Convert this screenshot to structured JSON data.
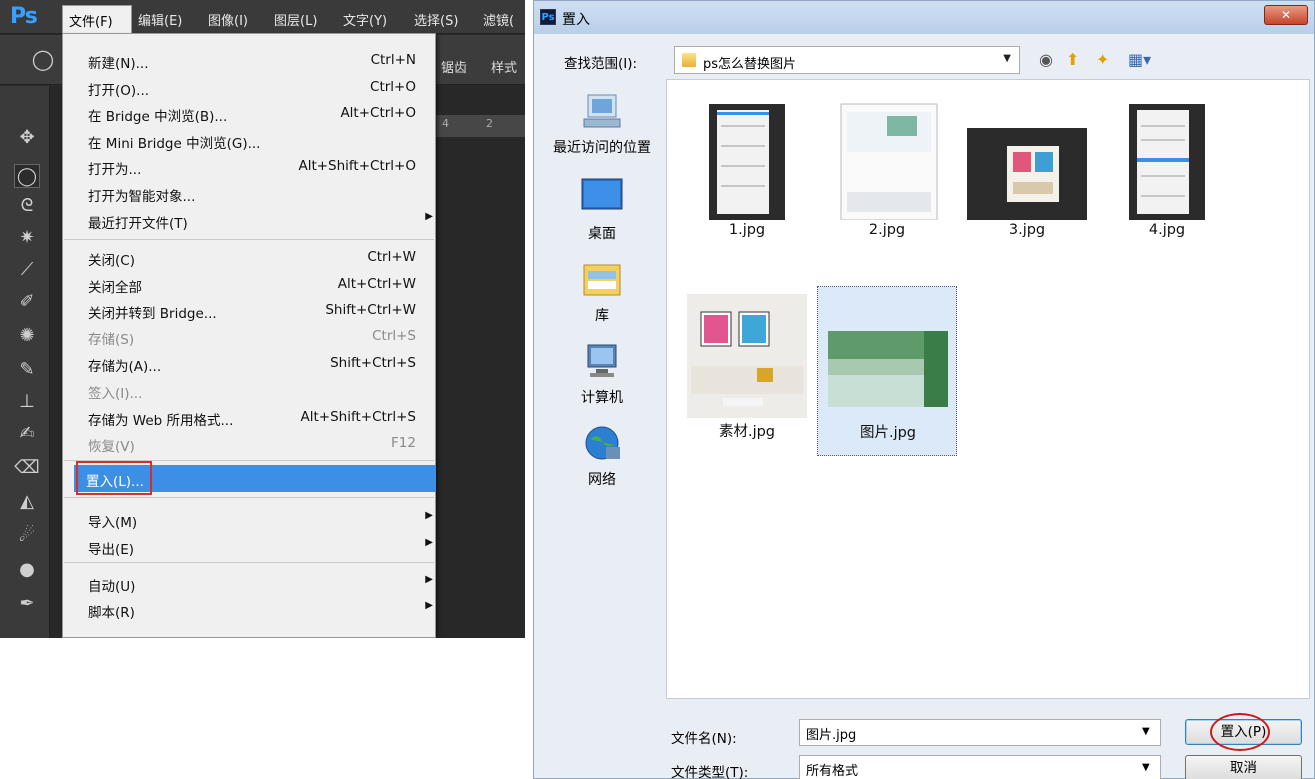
{
  "photoshop": {
    "logo": "Ps",
    "menubar": [
      {
        "label": "文件(F)"
      },
      {
        "label": "编辑(E)"
      },
      {
        "label": "图像(I)"
      },
      {
        "label": "图层(L)"
      },
      {
        "label": "文字(Y)"
      },
      {
        "label": "选择(S)"
      },
      {
        "label": "滤镜("
      }
    ],
    "optionbar": {
      "item1": "锯齿",
      "item2": "样式"
    },
    "ruler": {
      "tick1": "4",
      "tick2": "2"
    },
    "file_menu": {
      "items": [
        {
          "label": "新建(N)...",
          "shortcut": "Ctrl+N"
        },
        {
          "label": "打开(O)...",
          "shortcut": "Ctrl+O"
        },
        {
          "label": "在 Bridge 中浏览(B)...",
          "shortcut": "Alt+Ctrl+O"
        },
        {
          "label": "在 Mini Bridge 中浏览(G)...",
          "shortcut": ""
        },
        {
          "label": "打开为...",
          "shortcut": "Alt+Shift+Ctrl+O"
        },
        {
          "label": "打开为智能对象...",
          "shortcut": ""
        },
        {
          "label": "最近打开文件(T)",
          "shortcut": ""
        },
        {
          "label": "关闭(C)",
          "shortcut": "Ctrl+W"
        },
        {
          "label": "关闭全部",
          "shortcut": "Alt+Ctrl+W"
        },
        {
          "label": "关闭并转到 Bridge...",
          "shortcut": "Shift+Ctrl+W"
        },
        {
          "label": "存储(S)",
          "shortcut": "Ctrl+S"
        },
        {
          "label": "存储为(A)...",
          "shortcut": "Shift+Ctrl+S"
        },
        {
          "label": "签入(I)...",
          "shortcut": ""
        },
        {
          "label": "存储为 Web 所用格式...",
          "shortcut": "Alt+Shift+Ctrl+S"
        },
        {
          "label": "恢复(V)",
          "shortcut": "F12"
        },
        {
          "label": "置入(L)...",
          "shortcut": ""
        },
        {
          "label": "导入(M)",
          "shortcut": ""
        },
        {
          "label": "导出(E)",
          "shortcut": ""
        },
        {
          "label": "自动(U)",
          "shortcut": ""
        },
        {
          "label": "脚本(R)",
          "shortcut": ""
        }
      ]
    }
  },
  "dialog": {
    "title": "置入",
    "close": "✕",
    "look_in_label": "查找范围(I):",
    "look_in_value": "ps怎么替换图片",
    "places": [
      {
        "label": "最近访问的位置"
      },
      {
        "label": "桌面"
      },
      {
        "label": "库"
      },
      {
        "label": "计算机"
      },
      {
        "label": "网络"
      }
    ],
    "files": [
      {
        "name": "1.jpg"
      },
      {
        "name": "2.jpg"
      },
      {
        "name": "3.jpg"
      },
      {
        "name": "4.jpg"
      },
      {
        "name": "素材.jpg"
      },
      {
        "name": "图片.jpg"
      }
    ],
    "filename_label": "文件名(N):",
    "filename_value": "图片.jpg",
    "filetype_label": "文件类型(T):",
    "filetype_value": "所有格式",
    "place_button": "置入(P)",
    "cancel_button": "取消"
  }
}
